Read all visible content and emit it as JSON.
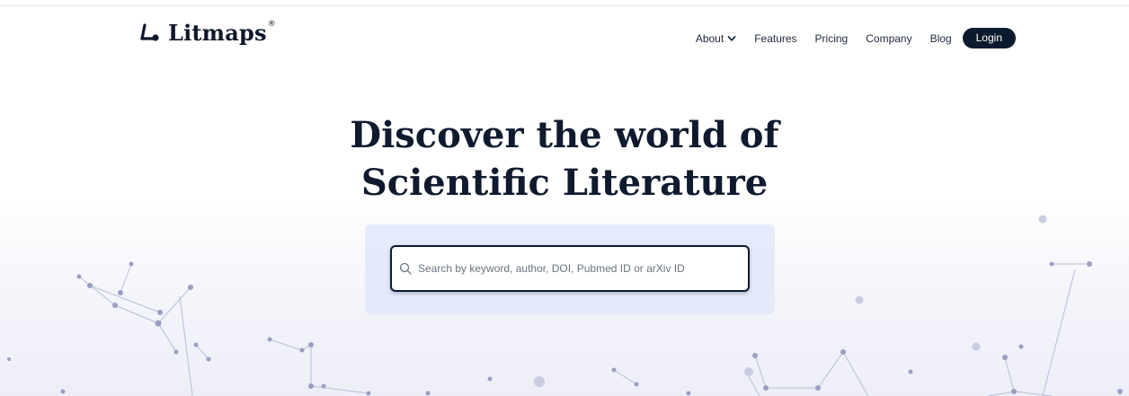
{
  "brand": {
    "name": "Litmaps",
    "registered_mark": "®",
    "icon": "litmaps-logo-icon"
  },
  "nav": {
    "items": [
      {
        "label": "About",
        "has_dropdown": true,
        "icon": "chevron-down-icon"
      },
      {
        "label": "Features"
      },
      {
        "label": "Pricing"
      },
      {
        "label": "Company"
      },
      {
        "label": "Blog"
      }
    ],
    "login_label": "Login"
  },
  "hero": {
    "title_line1": "Discover the world of",
    "title_line2": "Scientific Literature"
  },
  "search": {
    "value": "",
    "placeholder": "Search by keyword, author, DOI, Pubmed ID or arXiv ID",
    "icon": "search-icon"
  },
  "colors": {
    "text_dark": "#0f1a2e",
    "login_bg": "#0b1a2e",
    "search_panel_bg": "#e2e7fa",
    "network_node": "#9a9ec0",
    "network_line": "#b9bdd6"
  }
}
